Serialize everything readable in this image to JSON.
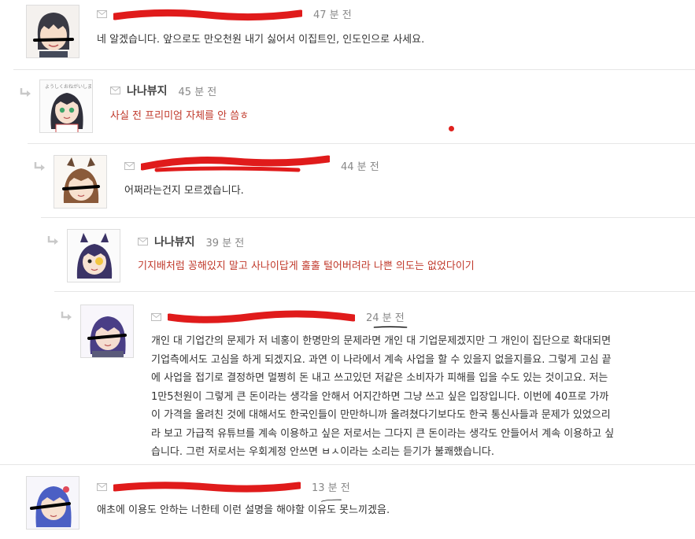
{
  "comments": [
    {
      "nick": "",
      "nick_redacted": true,
      "time": "47 분 전",
      "body": "네 알겠습니다. 앞으로도 만오천원 내기 싫어서 이집트인, 인도인으로 사세요.",
      "red_text": false
    },
    {
      "nick": "나나뷰지",
      "nick_redacted": false,
      "time": "45 분 전",
      "body": "사실 전 프리미엄 자체를 안 씀ㅎ",
      "red_text": true
    },
    {
      "nick": "",
      "nick_redacted": true,
      "time": "44 분 전",
      "body": "어쩌라는건지 모르겠습니다.",
      "red_text": false
    },
    {
      "nick": "나나뷰지",
      "nick_redacted": false,
      "time": "39 분 전",
      "body": "기지배처럼 꽁해있지 말고 사나이답게 훌훌 털어버려라 나쁜 의도는 없었다이기",
      "red_text": true
    },
    {
      "nick": "",
      "nick_redacted": true,
      "time": "24 분 전",
      "body_lines": [
        "개인 대 기업간의 문제가 저 네홍이 한명만의 문제라면 개인 대 기업문제겠지만 그 개인이 집단으로 확대되면",
        "기업측에서도 고심을 하게 되겠지요. 과연 이 나라에서 계속 사업을 할 수 있을지 없을지를요. 그렇게 고심 끝",
        "에 사업을 접기로 결정하면 멀쩡히 돈 내고 쓰고있던 저같은 소비자가 피해를 입을 수도 있는 것이고요. 저는",
        "1만5천원이 그렇게 큰 돈이라는 생각을 안해서 어지간하면 그냥 쓰고 싶은 입장입니다. 이번에 40프로 가까",
        "이 가격을 올려친 것에 대해서도 한국인들이 만만하니까 올려쳤다기보다도 한국 통신사들과 문제가 있었으리",
        "라 보고 가급적 유튜브를 계속 이용하고 싶은 저로서는 그다지 큰 돈이라는 생각도 안들어서 계속 이용하고 싶",
        "습니다. 그런 저로서는 우회계정 안쓰면 ㅂㅅ이라는 소리는 듣기가 불쾌했습니다."
      ],
      "red_text": false
    },
    {
      "nick": "",
      "nick_redacted": true,
      "time": "13 분 전",
      "body": "애초에 이용도 안하는 너한테 이런 설명을 해야할 이유도 못느끼겠음.",
      "red_text": false
    }
  ],
  "colors": {
    "redaction": "#e01b1b",
    "red_text": "#c0392b",
    "meta": "#888888",
    "border": "#e6e6e6",
    "reply_arrow": "#c9c9c9"
  },
  "icons": {
    "mail": "envelope-icon",
    "reply": "reply-arrow-icon"
  }
}
